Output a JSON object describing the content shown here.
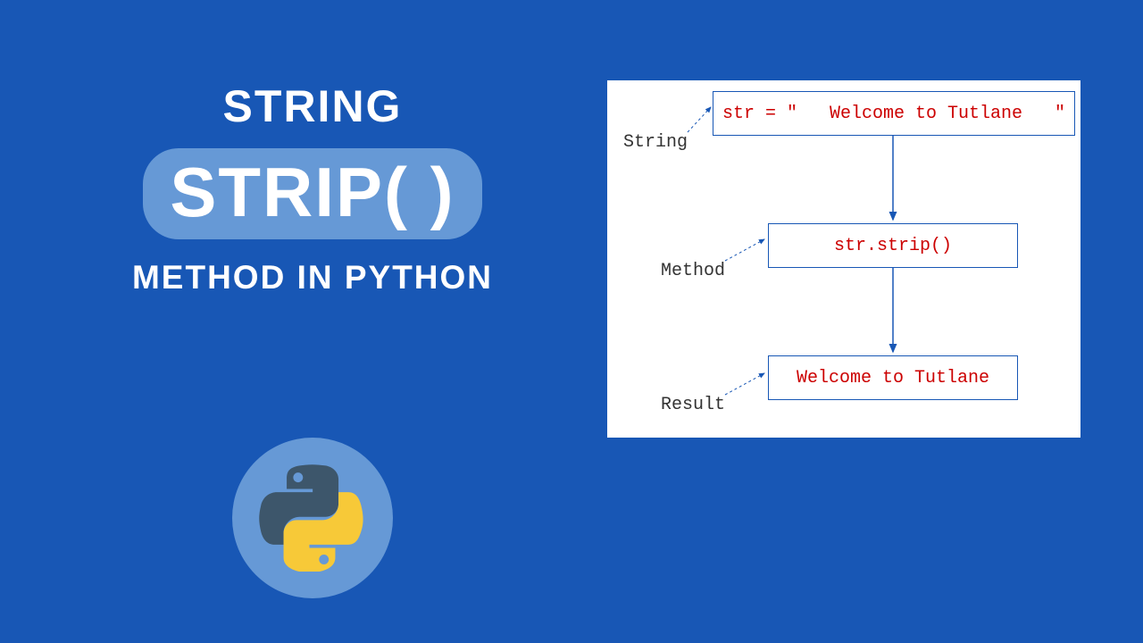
{
  "title": {
    "top": "STRING",
    "main": "STRIP( )",
    "bottom": "METHOD IN PYTHON"
  },
  "diagram": {
    "box1": "str = \"   Welcome to Tutlane   \"",
    "box2": "str.strip()",
    "box3": "Welcome to Tutlane",
    "label1": "String",
    "label2": "Method",
    "label3": "Result"
  },
  "chart_data": {
    "type": "diagram-flow",
    "nodes": [
      {
        "id": "string-box",
        "label": "String",
        "content": "str = \"   Welcome to Tutlane   \""
      },
      {
        "id": "method-box",
        "label": "Method",
        "content": "str.strip()"
      },
      {
        "id": "result-box",
        "label": "Result",
        "content": "Welcome to Tutlane"
      }
    ],
    "edges": [
      {
        "from": "string-box",
        "to": "method-box"
      },
      {
        "from": "method-box",
        "to": "result-box"
      }
    ]
  }
}
